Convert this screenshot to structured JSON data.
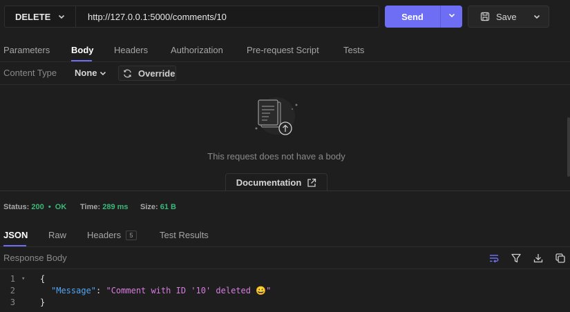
{
  "request": {
    "method": "DELETE",
    "url": "http://127.0.0.1:5000/comments/10",
    "send_label": "Send",
    "save_label": "Save"
  },
  "request_tabs": [
    {
      "label": "Parameters"
    },
    {
      "label": "Body",
      "active": true
    },
    {
      "label": "Headers"
    },
    {
      "label": "Authorization"
    },
    {
      "label": "Pre-request Script"
    },
    {
      "label": "Tests"
    }
  ],
  "body": {
    "content_type_label": "Content Type",
    "content_type_value": "None",
    "override_label": "Override",
    "empty_message": "This request does not have a body",
    "documentation_label": "Documentation"
  },
  "response": {
    "status_label": "Status:",
    "status_value": "200",
    "status_text": "OK",
    "time_label": "Time:",
    "time_value": "289 ms",
    "size_label": "Size:",
    "size_value": "61 B",
    "tabs": [
      {
        "label": "JSON",
        "active": true
      },
      {
        "label": "Raw"
      },
      {
        "label": "Headers",
        "badge": "5"
      },
      {
        "label": "Test Results"
      }
    ],
    "body_label": "Response Body",
    "line_numbers": [
      "1",
      "2",
      "3"
    ],
    "code": {
      "open": "{",
      "key": "\"Message\"",
      "colon": ": ",
      "value": "\"Comment with ID '10' deleted 😀\"",
      "close": "}"
    }
  },
  "colors": {
    "accent": "#6d6ef3",
    "status_ok": "#39b97a",
    "json_key": "#53a6f5",
    "json_string": "#d77de0"
  },
  "icons": [
    "chevron-down-icon",
    "save-icon",
    "refresh-icon",
    "document-upload-icon",
    "external-link-icon",
    "word-wrap-icon",
    "filter-icon",
    "download-icon",
    "copy-icon"
  ]
}
